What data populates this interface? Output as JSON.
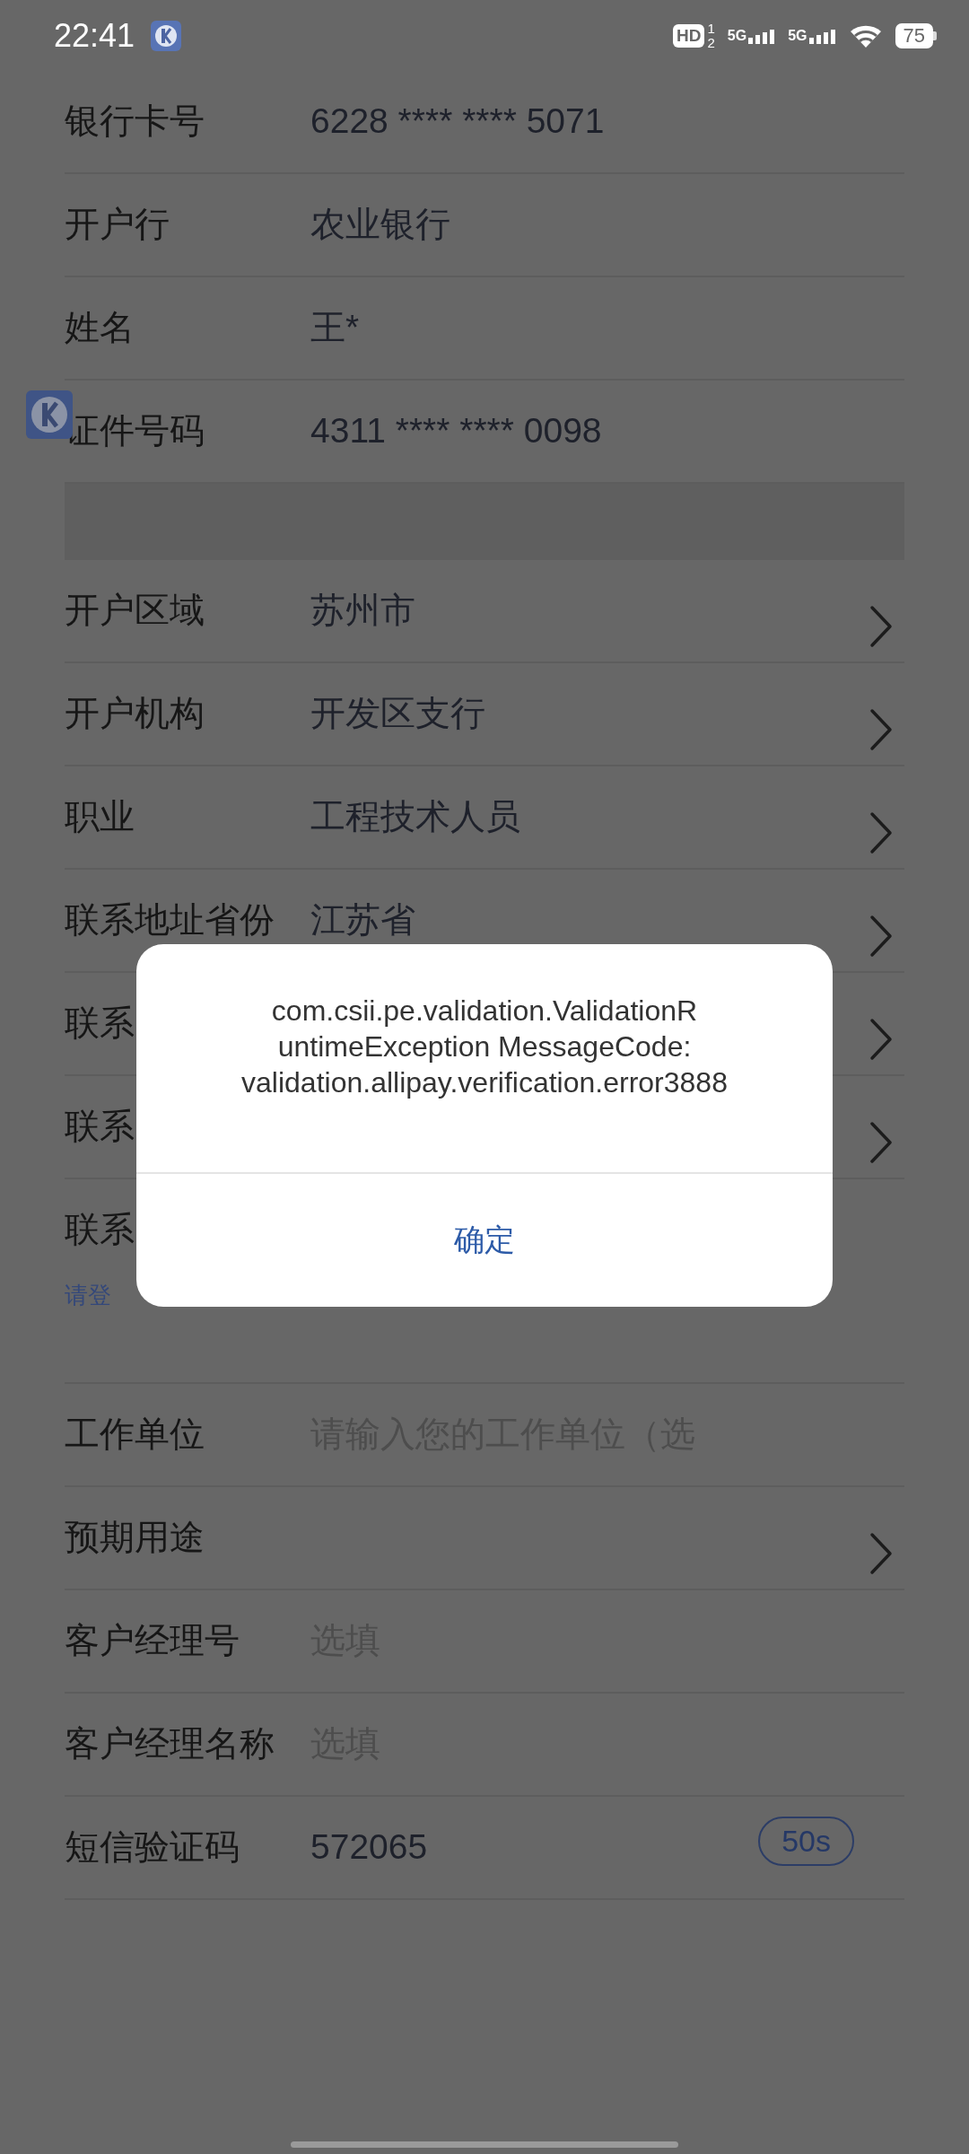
{
  "status_bar": {
    "time": "22:41",
    "hd": "HD",
    "hd_sub": [
      "1",
      "2"
    ],
    "networks": [
      "5G",
      "5G"
    ],
    "battery": "75"
  },
  "form": {
    "rows": [
      {
        "kind": "field",
        "label": "银行卡号",
        "value": "6228 **** **** 5071"
      },
      {
        "kind": "field",
        "label": "开户行",
        "value": "农业银行"
      },
      {
        "kind": "field",
        "label": "姓名",
        "value": "王*"
      },
      {
        "kind": "field",
        "label": "证件号码",
        "value": "4311 **** **** 0098"
      },
      {
        "kind": "band"
      },
      {
        "kind": "select",
        "label": "开户区域",
        "value": "苏州市"
      },
      {
        "kind": "select",
        "label": "开户机构",
        "value": "开发区支行"
      },
      {
        "kind": "select",
        "label": "职业",
        "value": "工程技术人员"
      },
      {
        "kind": "select",
        "label": "联系地址省份",
        "value": "江苏省"
      },
      {
        "kind": "select",
        "label": "联系"
      },
      {
        "kind": "select",
        "label": "联系"
      },
      {
        "kind": "field",
        "label": "联系",
        "hint": "请登"
      },
      {
        "kind": "input",
        "label": "工作单位",
        "placeholder": "请输入您的工作单位（选"
      },
      {
        "kind": "select",
        "label": "预期用途"
      },
      {
        "kind": "input",
        "label": "客户经理号",
        "placeholder": "选填"
      },
      {
        "kind": "input",
        "label": "客户经理名称",
        "placeholder": "选填"
      },
      {
        "kind": "sms",
        "label": "短信验证码",
        "value": "572065",
        "button": "50s"
      }
    ]
  },
  "dialog": {
    "message": "com.csii.pe.validation.ValidationR untimeException MessageCode: validation.allipay.verification.error3888",
    "button": "确定"
  }
}
